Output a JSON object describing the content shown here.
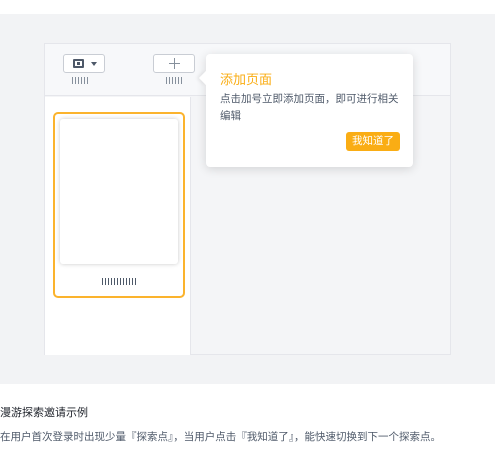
{
  "toolbar": {
    "view_select_icon": "grid-icon",
    "add_page_icon": "plus-icon"
  },
  "popover": {
    "title": "添加页面",
    "text": "点击加号立即添加页面，即可进行相关编辑",
    "confirm_label": "我知道了",
    "accent_color": "#faad14"
  },
  "sidebar": {
    "selected_border_color": "#fbb32d"
  },
  "caption": {
    "title": "漫游探索邀请示例",
    "description": "在用户首次登录时出现少量『探索点』，当用户点击『我知道了』，能快速切换到下一个探索点。"
  }
}
